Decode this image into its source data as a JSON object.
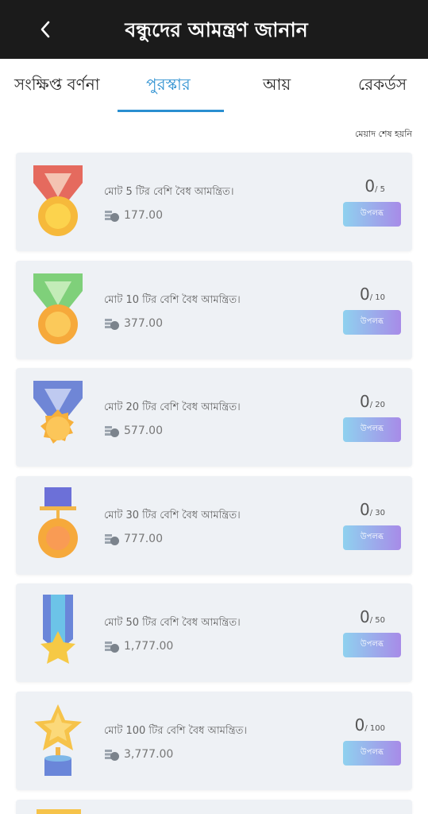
{
  "header": {
    "title": "বন্ধুদের আমন্ত্রণ জানান",
    "back_icon": "chevron-left-icon"
  },
  "tabs": [
    {
      "label": "সংক্ষিপ্ত বর্ণনা",
      "active": false
    },
    {
      "label": "পুরস্কার",
      "active": true
    },
    {
      "label": "আয়",
      "active": false
    },
    {
      "label": "রেকর্ডস",
      "active": false
    }
  ],
  "status_text": "মেয়াদ শেষ হয়নি",
  "colors": {
    "header_bg": "#1b1b1b",
    "accent": "#2a8fd0",
    "card_bg": "#eef1f5"
  },
  "cards": [
    {
      "medal": "red-ribbon-medal-icon",
      "desc": "মোট 5 টির বেশি বৈধ আমন্ত্রিত।",
      "amount": "177.00",
      "current": "0",
      "total": "/ 5",
      "button": "উপলব্ধ"
    },
    {
      "medal": "green-ribbon-medal-icon",
      "desc": "মোট 10 টির বেশি বৈধ আমন্ত্রিত।",
      "amount": "377.00",
      "current": "0",
      "total": "/ 10",
      "button": "উপলব্ধ"
    },
    {
      "medal": "blue-ribbon-medal-icon",
      "desc": "মোট 20 টির বেশি বৈধ আমন্ত্রিত।",
      "amount": "577.00",
      "current": "0",
      "total": "/ 20",
      "button": "উপলব্ধ"
    },
    {
      "medal": "purple-ribbon-medal-icon",
      "desc": "মোট 30 টির বেশি বৈধ আমন্ত্রিত।",
      "amount": "777.00",
      "current": "0",
      "total": "/ 30",
      "button": "উপলব্ধ"
    },
    {
      "medal": "star-ribbon-medal-icon",
      "desc": "মোট 50 টির বেশি বৈধ আমন্ত্রিত।",
      "amount": "1,777.00",
      "current": "0",
      "total": "/ 50",
      "button": "উপলব্ধ"
    },
    {
      "medal": "star-trophy-icon",
      "desc": "মোট 100 টির বেশি বৈধ আমন্ত্রিত।",
      "amount": "3,777.00",
      "current": "0",
      "total": "/ 100",
      "button": "উপলব্ধ"
    }
  ]
}
